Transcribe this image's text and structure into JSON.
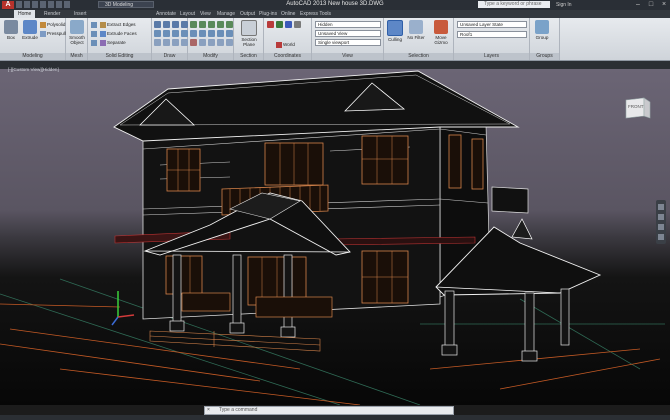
{
  "window": {
    "title": "AutoCAD 2013   New house 3D.DWG",
    "workspace": "3D Modeling",
    "search_placeholder": "Type a keyword or phrase",
    "sign_in": "Sign In"
  },
  "tabs": [
    "Home",
    "Render",
    "Insert",
    "Annotate",
    "Layout",
    "View",
    "Manage",
    "Output",
    "Plug-ins",
    "Online",
    "Express Tools"
  ],
  "ribbon": {
    "modeling": {
      "label": "Modeling",
      "box": "Box",
      "extrude": "Extrude",
      "polysolid": "Polysolid",
      "presspull": "Presspull"
    },
    "mesh": {
      "label": "Mesh",
      "smooth_object": "Smooth Object"
    },
    "solid_editing": {
      "label": "Solid Editing",
      "extract_edges": "Extract Edges",
      "extrude_faces": "Extrude Faces",
      "separate": "Separate"
    },
    "draw": {
      "label": "Draw"
    },
    "modify": {
      "label": "Modify"
    },
    "section": {
      "label": "Section",
      "section_plane": "Section Plane"
    },
    "coordinates": {
      "label": "Coordinates",
      "world": "World"
    },
    "view": {
      "label": "View",
      "visual_style": "Hidden",
      "view_name": "Unsaved View",
      "viewport": "Single viewport"
    },
    "selection": {
      "label": "Selection",
      "culling": "Culling",
      "no_filter": "No Filter",
      "move_gizmo": "Move Gizmo"
    },
    "layers": {
      "label": "Layers",
      "layer_state": "Unsaved Layer State",
      "current_layer": "Roof1"
    },
    "groups": {
      "label": "Groups",
      "group": "Group"
    }
  },
  "viewport": {
    "label": "[-][Custom View][Hidden]",
    "viewcube_face": "FRONT"
  },
  "command_line": {
    "placeholder": "Type a command"
  },
  "colors": {
    "accent": "#b8322b",
    "ribbon": "#dfe3e8",
    "viewport_top": "#5f5a66",
    "viewport_bottom": "#0a0a0a",
    "building": "#101010",
    "wire_orange": "#d5834a"
  }
}
